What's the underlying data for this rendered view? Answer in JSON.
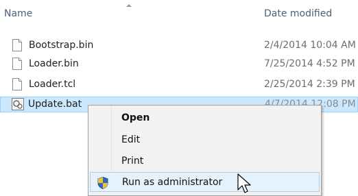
{
  "header": {
    "name_label": "Name",
    "date_label": "Date modified"
  },
  "files": [
    {
      "name": "Bootstrap.bin",
      "date": "2/4/2014 10:04 AM",
      "icon": "generic-file-icon"
    },
    {
      "name": "Loader.bin",
      "date": "7/25/2014 4:52 PM",
      "icon": "generic-file-icon"
    },
    {
      "name": "Loader.tcl",
      "date": "2/25/2014 2:39 PM",
      "icon": "generic-file-icon"
    },
    {
      "name": "Update.bat",
      "date": "4/7/2014 12:08 PM",
      "icon": "batch-file-icon",
      "selected": true
    }
  ],
  "context_menu": {
    "items": [
      {
        "label": "Open",
        "bold": true
      },
      {
        "label": "Edit"
      },
      {
        "label": "Print"
      },
      {
        "label": "Run as administrator",
        "icon": "uac-shield-icon",
        "hovered": true
      }
    ]
  },
  "colors": {
    "selection_bg": "#cce8ff",
    "menu_hover_bg": "#e5f1fb",
    "header_text": "#4c607a"
  }
}
